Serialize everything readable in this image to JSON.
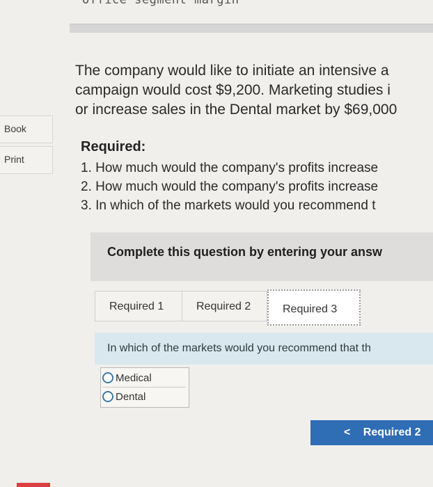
{
  "header": {
    "cut_title": "Office segment margin"
  },
  "sidebar": {
    "book_label": "Book",
    "print_label": "Print"
  },
  "intro": {
    "line1": "The company would like to initiate an intensive a",
    "line2": "campaign would cost $9,200. Marketing studies i",
    "line3": "or increase sales in the Dental market by $69,000"
  },
  "required": {
    "title": "Required:",
    "items": [
      "1. How much would the company's profits increase",
      "2. How much would the company's profits increase",
      "3. In which of the markets would you recommend t"
    ]
  },
  "instructions": {
    "text": "Complete this question by entering your answ"
  },
  "tabs": [
    {
      "label": "Required 1"
    },
    {
      "label": "Required 2"
    },
    {
      "label": "Required 3"
    }
  ],
  "question": {
    "text": "In which of the markets would you recommend that th"
  },
  "options": [
    {
      "label": "Medical",
      "selected": false
    },
    {
      "label": "Dental",
      "selected": false
    }
  ],
  "nav": {
    "prev_label": "Required 2",
    "prev_icon": "chevron-left-icon"
  },
  "colors": {
    "accent": "#2f6db5",
    "question_bg": "#d8e8ee",
    "bar_bg": "#dedddb"
  }
}
